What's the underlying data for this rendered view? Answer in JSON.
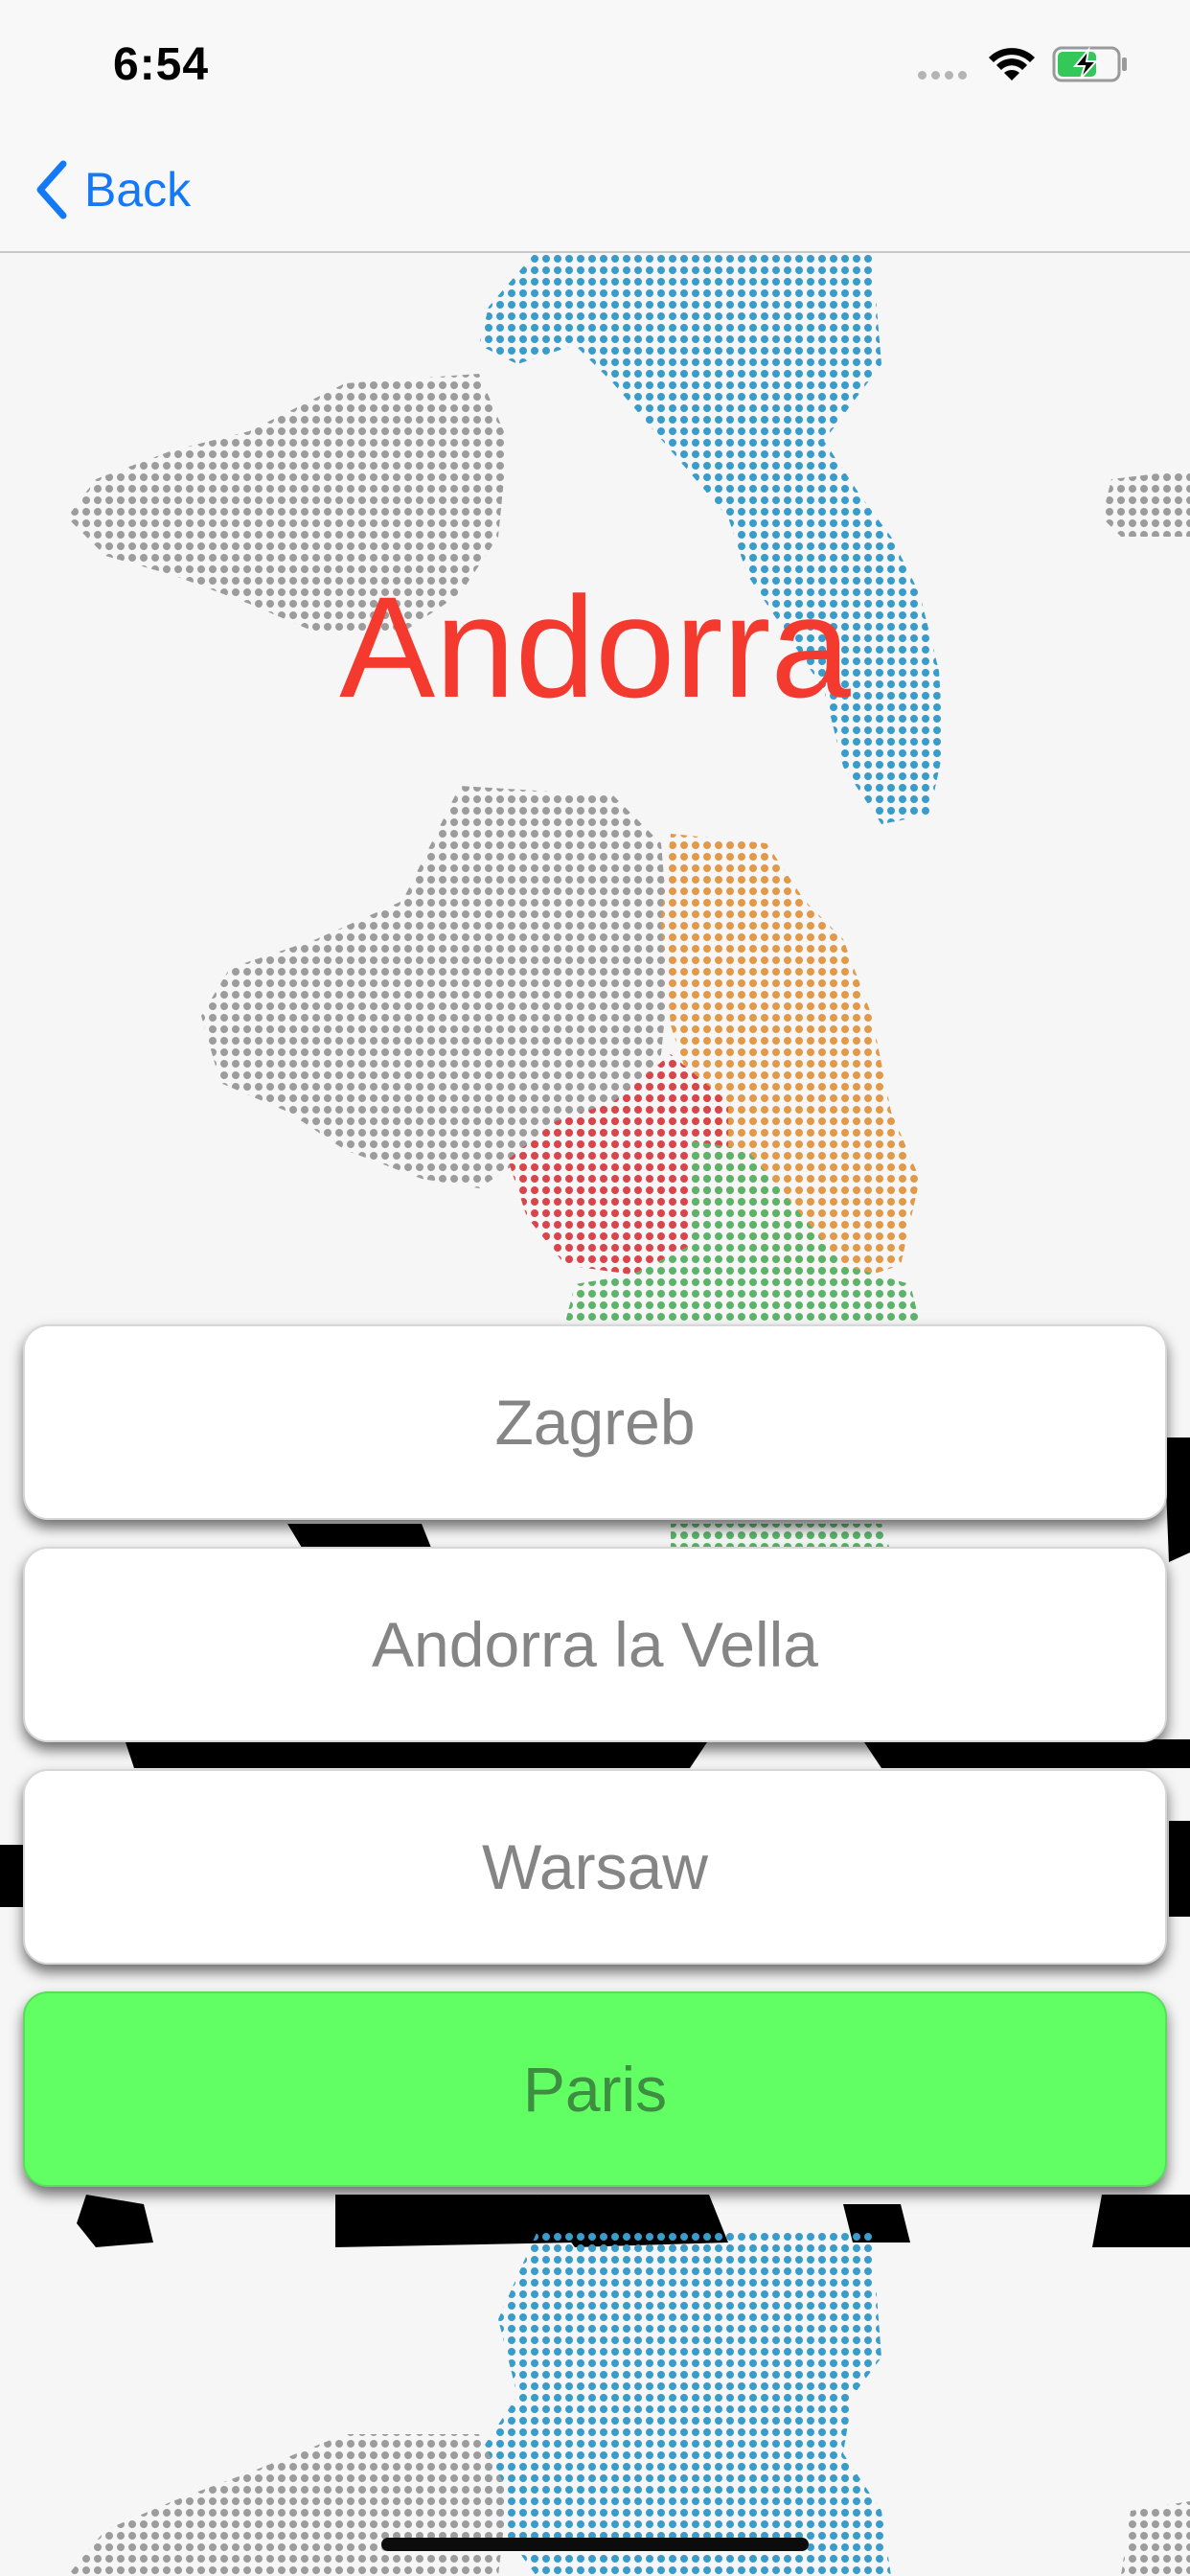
{
  "status_bar": {
    "time": "6:54",
    "icons": [
      "signal-dots-icon",
      "wifi-icon",
      "battery-charging-icon"
    ]
  },
  "nav": {
    "back_label": "Back",
    "back_icon": "chevron-left-icon"
  },
  "quiz": {
    "country": "Andorra",
    "answers": [
      {
        "label": "Zagreb",
        "state": "default"
      },
      {
        "label": "Andorra la Vella",
        "state": "default"
      },
      {
        "label": "Warsaw",
        "state": "default"
      },
      {
        "label": "Paris",
        "state": "highlighted"
      }
    ]
  },
  "colors": {
    "accent_blue": "#1479f6",
    "title_red": "#f43a2f",
    "highlight_green": "#62ff64",
    "answer_text": "#858585",
    "map_gray": "#9c9c9c",
    "map_blue": "#3a9cc8",
    "map_orange": "#e09a4a",
    "map_red": "#d8454a",
    "map_green": "#5db36a"
  }
}
